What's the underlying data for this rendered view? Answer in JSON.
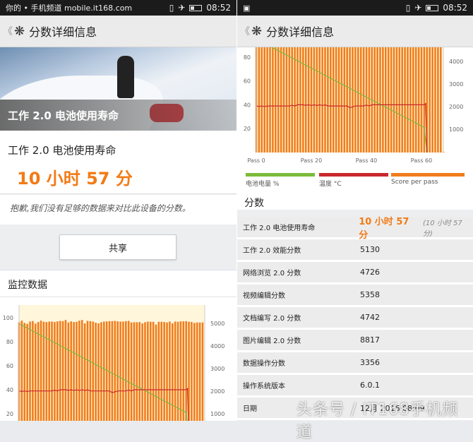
{
  "status": {
    "carrier": "你的 • 手机频道 mobile.it168.com",
    "time": "08:52"
  },
  "header": {
    "title": "分数详细信息",
    "back": "《",
    "logo": "❋"
  },
  "hero": {
    "title": "工作 2.0 电池使用寿命"
  },
  "result": {
    "title": "工作 2.0 电池使用寿命",
    "value": "10 小时 57 分"
  },
  "sorry": "抱歉,我们没有足够的数据来对比此设备的分数。",
  "share": "共享",
  "monitor": {
    "title": "监控数据"
  },
  "legend": [
    "电池电量 %",
    "温度 °C",
    "Score per pass"
  ],
  "scores_title": "分数",
  "rows": [
    {
      "k": "工作 2.0 电池使用寿命",
      "v": "10 小时 57 分",
      "sub": "(10 小时 57 分)"
    },
    {
      "k": "工作 2.0 效能分数",
      "v": "5130"
    },
    {
      "k": "网络浏览 2.0 分数",
      "v": "4726"
    },
    {
      "k": "视频编辑分数",
      "v": "5358"
    },
    {
      "k": "文档编写 2.0 分数",
      "v": "4742"
    },
    {
      "k": "图片编辑 2.0 分数",
      "v": "8817"
    },
    {
      "k": "数据操作分数",
      "v": "3356"
    },
    {
      "k": "操作系统版本",
      "v": "6.0.1"
    },
    {
      "k": "日期",
      "v": "12月 2016 08:09"
    }
  ],
  "watermark": "头条号 / IT168手机频道",
  "colors": {
    "battery": "#7cbb3a",
    "temp": "#c9282d",
    "score": "#f07d1c",
    "accent": "#f27b16"
  },
  "chart_data": {
    "type": "bar",
    "xlabel": "",
    "x_ticks": [
      "Pass 0",
      "Pass 20",
      "Pass 40",
      "Pass 60"
    ],
    "y_left_ticks": [
      "20",
      "40",
      "60",
      "80",
      "100"
    ],
    "y_right_ticks": [
      "1000",
      "2000",
      "3000",
      "4000",
      "5000"
    ],
    "y_left_range": [
      0,
      110
    ],
    "y_right_range": [
      0,
      5500
    ],
    "series": [
      {
        "name": "Score per pass",
        "axis": "right",
        "values": [
          5050,
          5120,
          5020,
          4980,
          5080,
          5100,
          4990,
          5060,
          5120,
          5070,
          5060,
          5080,
          5080,
          5060,
          5090,
          5110,
          5100,
          5150,
          5040,
          5090,
          5060,
          5070,
          5120,
          5150,
          5000,
          5110,
          5100,
          5080,
          5030,
          5000,
          5050,
          5080,
          5090,
          5100,
          5100,
          5110,
          5090,
          5080,
          5080,
          5100,
          5110,
          5040,
          5050,
          5050,
          5060,
          5000,
          5050,
          5080,
          5070,
          5070,
          4950,
          5070,
          5070,
          5060,
          5040,
          5080,
          5000,
          5080,
          5070,
          5090,
          5090,
          5100,
          5070,
          5060,
          5020,
          5040,
          5040,
          5040,
          0
        ]
      },
      {
        "name": "电池电量 %",
        "axis": "left",
        "points": [
          [
            0,
            95
          ],
          [
            61,
            21
          ],
          [
            62,
            0
          ]
        ]
      },
      {
        "name": "温度 °C",
        "axis": "left",
        "points": [
          [
            0,
            39
          ],
          [
            1,
            38.6
          ],
          [
            2,
            39
          ],
          [
            3,
            38.5
          ],
          [
            4,
            39
          ],
          [
            12,
            39
          ],
          [
            13,
            39.6
          ],
          [
            14,
            39
          ],
          [
            15,
            40
          ],
          [
            17,
            40
          ],
          [
            18,
            39.5
          ],
          [
            19,
            40
          ],
          [
            20,
            39.4
          ],
          [
            21,
            40
          ],
          [
            22,
            39.4
          ],
          [
            23,
            40
          ],
          [
            24,
            39.4
          ],
          [
            25,
            40
          ],
          [
            26,
            39
          ],
          [
            33,
            39
          ],
          [
            34,
            37.6
          ],
          [
            35,
            38.3
          ],
          [
            36,
            39
          ],
          [
            39,
            39
          ],
          [
            40,
            39.8
          ],
          [
            41,
            39
          ],
          [
            42,
            40
          ],
          [
            61,
            40
          ],
          [
            61.5,
            41
          ],
          [
            62,
            0
          ]
        ]
      }
    ]
  }
}
